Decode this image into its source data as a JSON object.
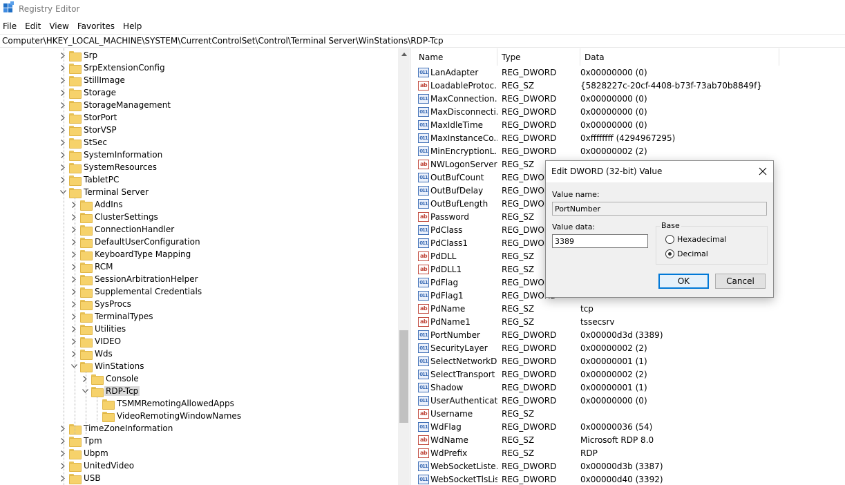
{
  "window": {
    "title": "Registry Editor"
  },
  "menu": [
    "File",
    "Edit",
    "View",
    "Favorites",
    "Help"
  ],
  "address": "Computer\\HKEY_LOCAL_MACHINE\\SYSTEM\\CurrentControlSet\\Control\\Terminal Server\\WinStations\\RDP-Tcp",
  "tree": [
    {
      "label": "Srp",
      "expanded": false
    },
    {
      "label": "SrpExtensionConfig",
      "expanded": false
    },
    {
      "label": "StillImage",
      "expanded": false
    },
    {
      "label": "Storage",
      "expanded": false
    },
    {
      "label": "StorageManagement",
      "expanded": false
    },
    {
      "label": "StorPort",
      "expanded": false
    },
    {
      "label": "StorVSP",
      "expanded": false
    },
    {
      "label": "StSec",
      "expanded": false
    },
    {
      "label": "SystemInformation",
      "expanded": false
    },
    {
      "label": "SystemResources",
      "expanded": false
    },
    {
      "label": "TabletPC",
      "expanded": false
    },
    {
      "label": "Terminal Server",
      "expanded": true
    },
    {
      "label": "AddIns",
      "expanded": false
    },
    {
      "label": "ClusterSettings",
      "expanded": false
    },
    {
      "label": "ConnectionHandler",
      "expanded": false
    },
    {
      "label": "DefaultUserConfiguration",
      "expanded": false
    },
    {
      "label": "KeyboardType Mapping",
      "expanded": false
    },
    {
      "label": "RCM",
      "expanded": false
    },
    {
      "label": "SessionArbitrationHelper",
      "expanded": false
    },
    {
      "label": "Supplemental Credentials",
      "expanded": false
    },
    {
      "label": "SysProcs",
      "expanded": false
    },
    {
      "label": "TerminalTypes",
      "expanded": false
    },
    {
      "label": "Utilities",
      "expanded": false
    },
    {
      "label": "VIDEO",
      "expanded": false
    },
    {
      "label": "Wds",
      "expanded": false
    },
    {
      "label": "WinStations",
      "expanded": true
    },
    {
      "label": "Console",
      "expanded": false
    },
    {
      "label": "RDP-Tcp",
      "expanded": true,
      "selected": true
    },
    {
      "label": "TSMMRemotingAllowedApps",
      "expanded": false
    },
    {
      "label": "VideoRemotingWindowNames",
      "expanded": false
    },
    {
      "label": "TimeZoneInformation",
      "expanded": false
    },
    {
      "label": "Tpm",
      "expanded": false
    },
    {
      "label": "Ubpm",
      "expanded": false
    },
    {
      "label": "UnitedVideo",
      "expanded": false
    },
    {
      "label": "USB",
      "expanded": false
    }
  ],
  "columns": {
    "name": "Name",
    "type": "Type",
    "data": "Data"
  },
  "values": [
    {
      "name": "LanAdapter",
      "type": "REG_DWORD",
      "data": "0x00000000 (0)",
      "icon": "binary-value-icon"
    },
    {
      "name": "LoadableProtoc...",
      "type": "REG_SZ",
      "data": "{5828227c-20cf-4408-b73f-73ab70b8849f}",
      "icon": "string-value-icon"
    },
    {
      "name": "MaxConnection...",
      "type": "REG_DWORD",
      "data": "0x00000000 (0)",
      "icon": "binary-value-icon"
    },
    {
      "name": "MaxDisconnecti...",
      "type": "REG_DWORD",
      "data": "0x00000000 (0)",
      "icon": "binary-value-icon"
    },
    {
      "name": "MaxIdleTime",
      "type": "REG_DWORD",
      "data": "0x00000000 (0)",
      "icon": "binary-value-icon"
    },
    {
      "name": "MaxInstanceCo...",
      "type": "REG_DWORD",
      "data": "0xffffffff (4294967295)",
      "icon": "binary-value-icon"
    },
    {
      "name": "MinEncryptionL...",
      "type": "REG_DWORD",
      "data": "0x00000002 (2)",
      "icon": "binary-value-icon"
    },
    {
      "name": "NWLogonServer",
      "type": "REG_SZ",
      "data": "",
      "icon": "string-value-icon"
    },
    {
      "name": "OutBufCount",
      "type": "REG_DWORD",
      "data": "",
      "icon": "binary-value-icon"
    },
    {
      "name": "OutBufDelay",
      "type": "REG_DWORD",
      "data": "",
      "icon": "binary-value-icon"
    },
    {
      "name": "OutBufLength",
      "type": "REG_DWORD",
      "data": "",
      "icon": "binary-value-icon"
    },
    {
      "name": "Password",
      "type": "REG_SZ",
      "data": "",
      "icon": "string-value-icon"
    },
    {
      "name": "PdClass",
      "type": "REG_DWORD",
      "data": "",
      "icon": "binary-value-icon"
    },
    {
      "name": "PdClass1",
      "type": "REG_DWORD",
      "data": "",
      "icon": "binary-value-icon"
    },
    {
      "name": "PdDLL",
      "type": "REG_SZ",
      "data": "",
      "icon": "string-value-icon"
    },
    {
      "name": "PdDLL1",
      "type": "REG_SZ",
      "data": "",
      "icon": "string-value-icon"
    },
    {
      "name": "PdFlag",
      "type": "REG_DWORD",
      "data": "",
      "icon": "binary-value-icon"
    },
    {
      "name": "PdFlag1",
      "type": "REG_DWORD",
      "data": "",
      "icon": "binary-value-icon"
    },
    {
      "name": "PdName",
      "type": "REG_SZ",
      "data": "tcp",
      "icon": "string-value-icon"
    },
    {
      "name": "PdName1",
      "type": "REG_SZ",
      "data": "tssecsrv",
      "icon": "string-value-icon"
    },
    {
      "name": "PortNumber",
      "type": "REG_DWORD",
      "data": "0x00000d3d (3389)",
      "icon": "binary-value-icon",
      "selected": true
    },
    {
      "name": "SecurityLayer",
      "type": "REG_DWORD",
      "data": "0x00000002 (2)",
      "icon": "binary-value-icon"
    },
    {
      "name": "SelectNetworkD...",
      "type": "REG_DWORD",
      "data": "0x00000001 (1)",
      "icon": "binary-value-icon"
    },
    {
      "name": "SelectTransport",
      "type": "REG_DWORD",
      "data": "0x00000002 (2)",
      "icon": "binary-value-icon"
    },
    {
      "name": "Shadow",
      "type": "REG_DWORD",
      "data": "0x00000001 (1)",
      "icon": "binary-value-icon"
    },
    {
      "name": "UserAuthenticat...",
      "type": "REG_DWORD",
      "data": "0x00000000 (0)",
      "icon": "binary-value-icon"
    },
    {
      "name": "Username",
      "type": "REG_SZ",
      "data": "",
      "icon": "string-value-icon"
    },
    {
      "name": "WdFlag",
      "type": "REG_DWORD",
      "data": "0x00000036 (54)",
      "icon": "binary-value-icon"
    },
    {
      "name": "WdName",
      "type": "REG_SZ",
      "data": "Microsoft RDP 8.0",
      "icon": "string-value-icon"
    },
    {
      "name": "WdPrefix",
      "type": "REG_SZ",
      "data": "RDP",
      "icon": "string-value-icon"
    },
    {
      "name": "WebSocketListe...",
      "type": "REG_DWORD",
      "data": "0x00000d3b (3387)",
      "icon": "binary-value-icon"
    },
    {
      "name": "WebSocketTlsLis...",
      "type": "REG_DWORD",
      "data": "0x00000d40 (3392)",
      "icon": "binary-value-icon"
    }
  ],
  "dialog": {
    "title": "Edit DWORD (32-bit) Value",
    "value_name_label": "Value name:",
    "value_name": "PortNumber",
    "value_data_label": "Value data:",
    "value_data": "3389",
    "base_label": "Base",
    "hex_label": "Hexadecimal",
    "dec_label": "Decimal",
    "base_selected": "Decimal",
    "ok": "OK",
    "cancel": "Cancel"
  },
  "colors": {
    "folder": "#f6d26b",
    "selection": "#d9d9d9",
    "default_button_border": "#0078d7"
  }
}
